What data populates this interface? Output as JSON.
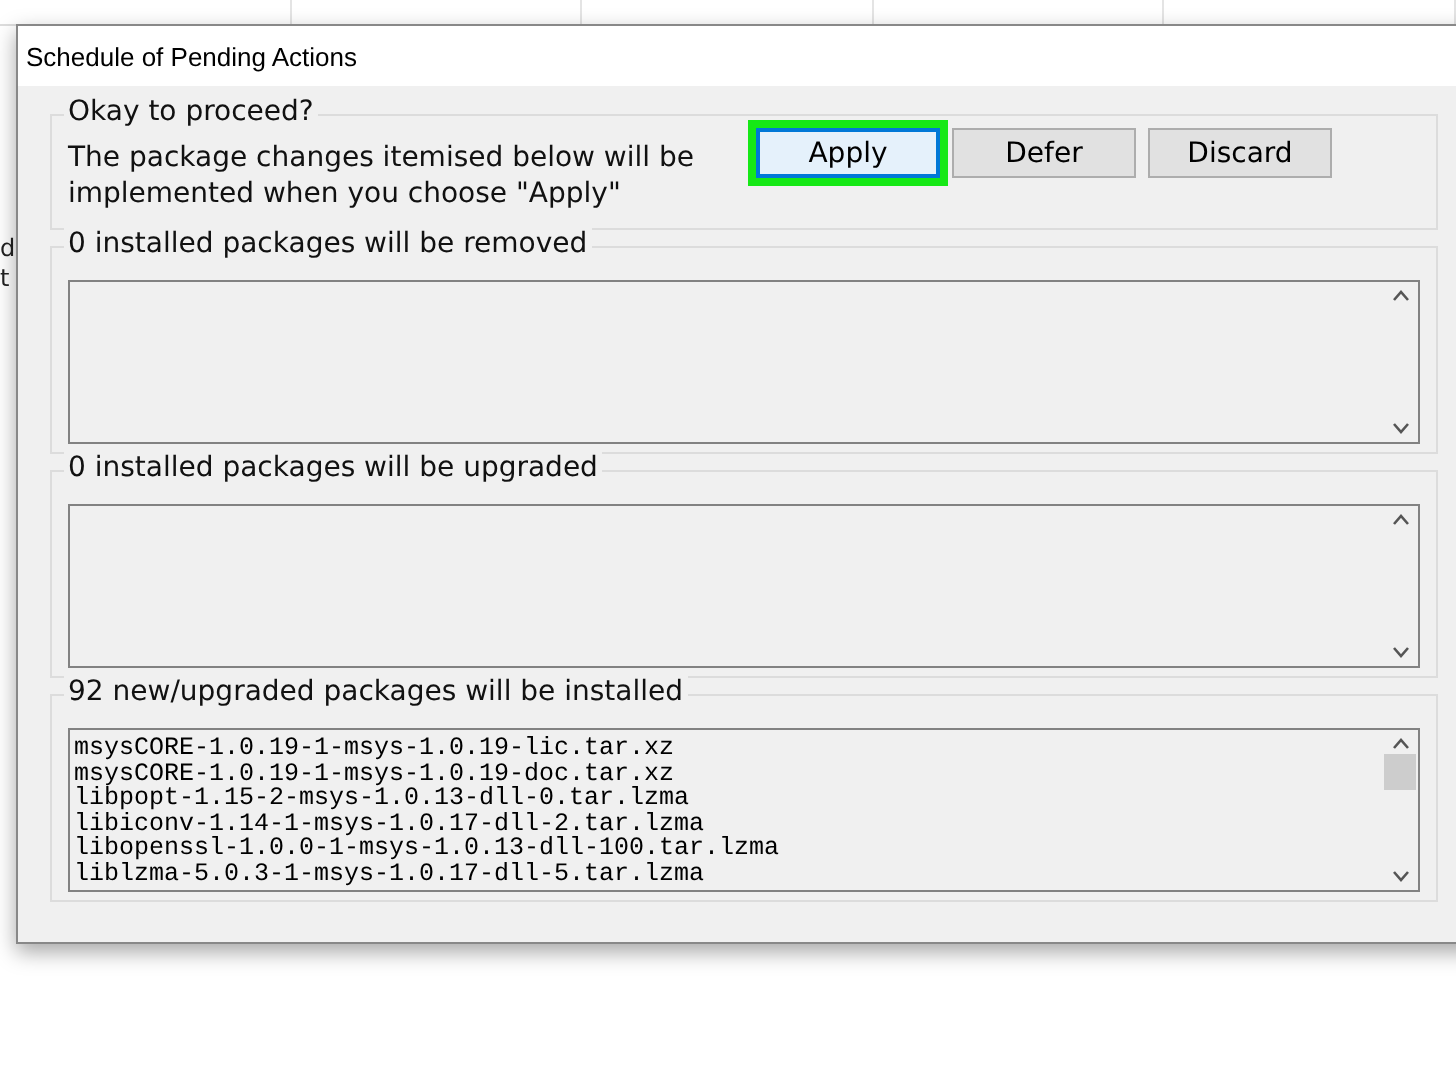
{
  "background_window": {
    "fragments": [
      "d",
      "t"
    ]
  },
  "window": {
    "title": "Schedule of Pending Actions"
  },
  "prompt": {
    "heading": "Okay to proceed?",
    "message": "The package changes itemised below will be implemented when you choose \"Apply\"",
    "buttons": [
      {
        "label": "Apply",
        "default": true,
        "highlighted": true
      },
      {
        "label": "Defer",
        "default": false,
        "highlighted": false
      },
      {
        "label": "Discard",
        "default": false,
        "highlighted": false
      }
    ]
  },
  "groups": [
    {
      "heading": "0 installed packages will be removed"
    },
    {
      "heading": "0 installed packages will be upgraded"
    },
    {
      "heading": "92 new/upgraded packages will be installed",
      "items": [
        "msysCORE-1.0.19-1-msys-1.0.19-lic.tar.xz",
        "msysCORE-1.0.19-1-msys-1.0.19-doc.tar.xz",
        "libpopt-1.15-2-msys-1.0.13-dll-0.tar.lzma",
        "libiconv-1.14-1-msys-1.0.17-dll-2.tar.lzma",
        "libopenssl-1.0.0-1-msys-1.0.13-dll-100.tar.lzma",
        "liblzma-5.0.3-1-msys-1.0.17-dll-5.tar.lzma"
      ]
    }
  ]
}
